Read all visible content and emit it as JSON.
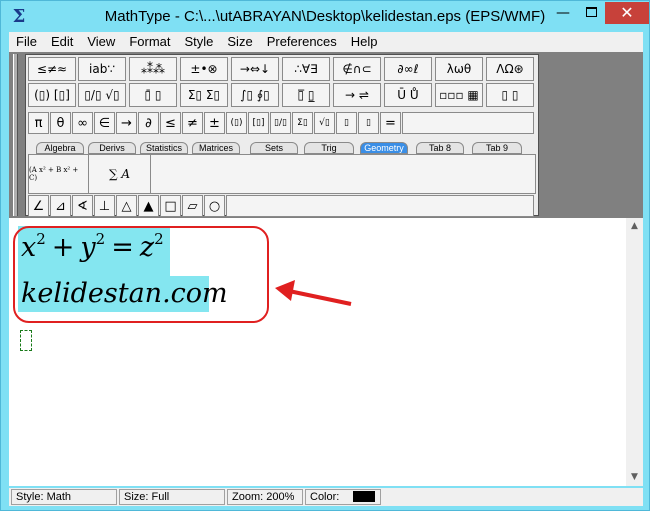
{
  "window": {
    "title": "MathType - C:\\...\\utABRAYAN\\Desktop\\kelidestan.eps (EPS/WMF)",
    "app_icon": "Σ",
    "minimize_glyph": "—",
    "close_glyph": "✕"
  },
  "menu": [
    "File",
    "Edit",
    "View",
    "Format",
    "Style",
    "Size",
    "Preferences",
    "Help"
  ],
  "toolbar": {
    "symbol_row": [
      "≤≠≈",
      "ⅰab∵",
      "⁎⁑⁂",
      "±•⊗",
      "→⇔↓",
      "∴∀∃",
      "∉∩⊂",
      "∂∞ℓ",
      "λωθ",
      "ΛΩ⊛"
    ],
    "template_row": [
      "(▯) [▯]",
      "▯/▯ √▯",
      "▯̄ ▯",
      "Σ▯ Σ▯",
      "∫▯ ∮▯",
      "▯̅ ▯̲",
      "→ ⇌",
      "Ū Ů",
      "▫▫▫ ▦",
      "▯ ▯"
    ],
    "small_row": [
      "π",
      "θ",
      "∞",
      "∈",
      "→",
      "∂",
      "≤",
      "≠",
      "±",
      "(▯)",
      "[▯]",
      "▯/▯",
      "Σ▯",
      "√▯",
      "▯",
      "▯",
      "="
    ],
    "tabs": [
      "Algebra",
      "Derivs",
      "Statistics",
      "Matrices",
      "Sets",
      "Trig",
      "Geometry",
      "Tab 8",
      "Tab 9"
    ],
    "active_tab": "Geometry",
    "tab_template_1": "(A x² + B x² + C)",
    "tab_template_2": "∑ A",
    "geometry_row": [
      "∠",
      "⊿",
      "∢",
      "⊥",
      "△",
      "▲",
      "□",
      "▱",
      "○"
    ]
  },
  "editor": {
    "equation": {
      "x": "x",
      "x_exp": "2",
      "plus": "+",
      "y": "y",
      "y_exp": "2",
      "equals": "=",
      "z": "z",
      "z_exp": "2"
    },
    "text_line": "kelidestan.com"
  },
  "status": {
    "style": "Style: Math",
    "size": "Size: Full",
    "zoom": "Zoom: 200%",
    "color_label": "Color:",
    "color_value": "#000000"
  },
  "colors": {
    "window_frame": "#7fe0f4",
    "highlight": "#84e6f0",
    "callout": "#e02020",
    "active_tab": "#3a8ee6"
  },
  "icons": {
    "scroll_up": "▲",
    "scroll_down": "▼"
  }
}
